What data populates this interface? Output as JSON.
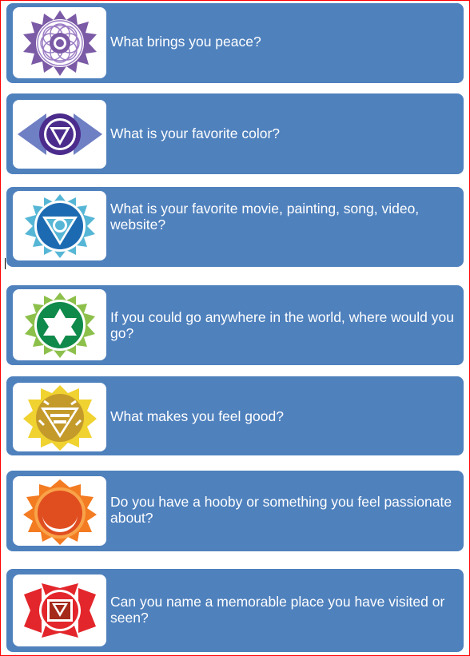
{
  "cards": [
    {
      "question": "What brings you peace?",
      "icon": "crown-chakra-icon",
      "color": "#7b5aa6"
    },
    {
      "question": "What is your favorite color?",
      "icon": "third-eye-chakra-icon",
      "color": "#4b2c8c"
    },
    {
      "question": "What is your favorite movie, painting, song, video, website?",
      "icon": "throat-chakra-icon",
      "color": "#1c6bb2"
    },
    {
      "question": "If you could go anywhere in the world, where would you go?",
      "icon": "heart-chakra-icon",
      "color": "#0f8a4a"
    },
    {
      "question": "What makes you feel good?",
      "icon": "solar-plexus-chakra-icon",
      "color": "#e8c81e"
    },
    {
      "question": "Do you have a hooby or something you feel passionate about?",
      "icon": "sacral-chakra-icon",
      "color": "#f37b21"
    },
    {
      "question": "Can you name a memorable place you have visited or seen?",
      "icon": "root-chakra-icon",
      "color": "#e3262b"
    }
  ],
  "colors": {
    "card_bg": "#4f81bd",
    "frame": "#ff0000"
  }
}
